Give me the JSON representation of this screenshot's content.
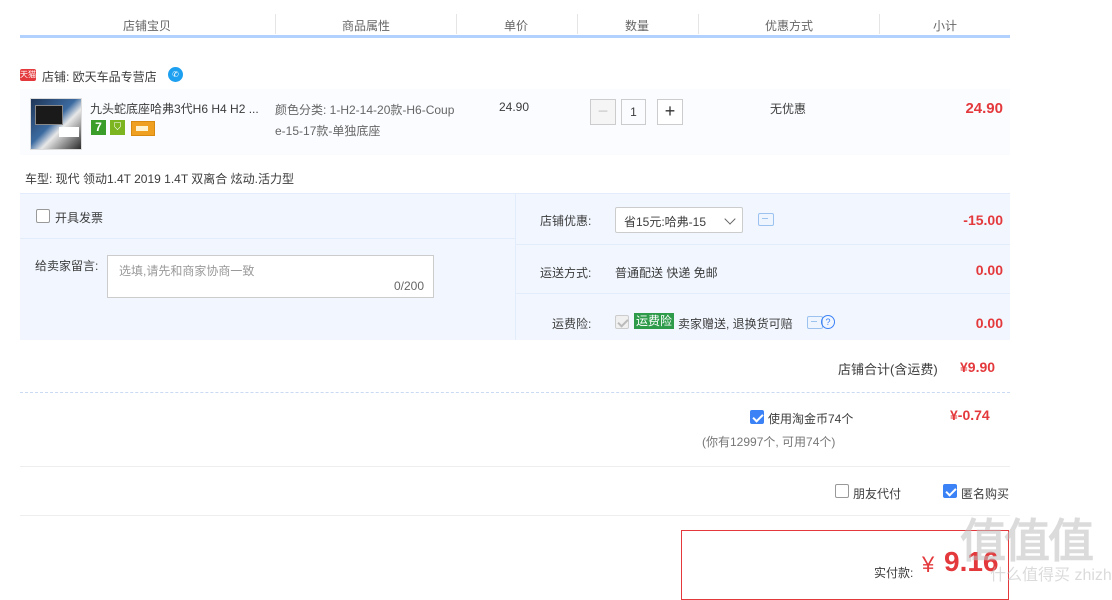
{
  "columns": [
    "店铺宝贝",
    "商品属性",
    "单价",
    "数量",
    "优惠方式",
    "小计"
  ],
  "shop": {
    "badge": "天猫",
    "label": "店铺: 欧天车品专营店"
  },
  "item": {
    "title": "九头蛇底座哈弗3代H6 H4 H2 ...",
    "tags": [
      "7"
    ],
    "attr": "颜色分类: 1-H2-14-20款-H6-Coupe-15-17款-单独底座",
    "price": "24.90",
    "quantity": "1",
    "promo": "无优惠",
    "subtotal": "24.90",
    "car_model": "车型: 现代 领动1.4T 2019 1.4T 双离合 炫动.活力型"
  },
  "options": {
    "invoice_label": "开具发票",
    "message_label": "给卖家留言:",
    "message_placeholder": "选填,请先和商家协商一致",
    "message_count": "0/200",
    "shop_promo_label": "店铺优惠:",
    "shop_promo_value": "省15元:哈弗-15",
    "shop_promo_amount": "-15.00",
    "delivery_label": "运送方式:",
    "delivery_value": "普通配送 快递 免邮",
    "delivery_amount": "0.00",
    "freight_label": "运费险:",
    "freight_badge": "运费险",
    "freight_text": "卖家赠送, 退换货可赔",
    "freight_amount": "0.00"
  },
  "shop_total": {
    "label": "店铺合计(含运费)",
    "amount": "¥9.90"
  },
  "coins": {
    "label": "使用淘金币74个",
    "sub": "(你有12997个, 可用74个)",
    "amount": "¥-0.74"
  },
  "extras": {
    "friend_pay": "朋友代付",
    "anonymous": "匿名购买"
  },
  "payment": {
    "label": "实付款:",
    "currency": "¥",
    "amount": "9.16"
  },
  "watermark": {
    "chars": "值值值",
    "url": "什么值得买 zhizhi.com"
  }
}
